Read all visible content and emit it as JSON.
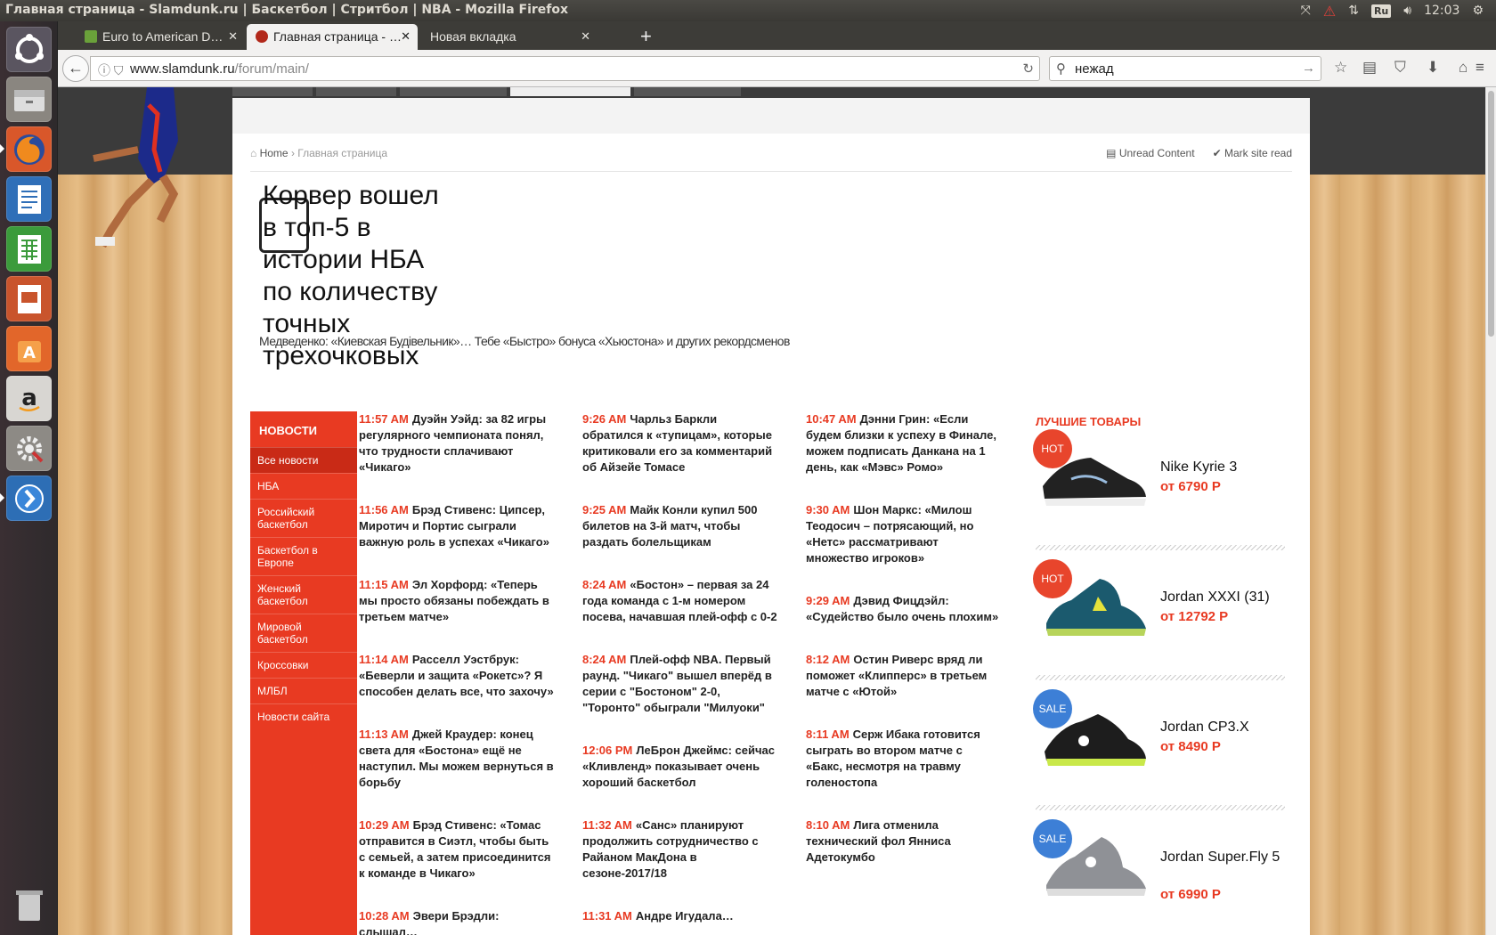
{
  "os": {
    "window_title": "Главная страница - Slamdunk.ru | Баскетбол | Стритбол | NBA - Mozilla Firefox",
    "keyboard_layout": "Ru",
    "clock": "12:03"
  },
  "browser": {
    "tabs": [
      {
        "label": "Euro to American D…"
      },
      {
        "label": "Главная страница - …"
      },
      {
        "label": "Новая вкладка"
      }
    ],
    "url_host": "www.slamdunk.ru",
    "url_path": "/forum/main/",
    "search_value": "нежад"
  },
  "page": {
    "breadcrumb": {
      "home": "Home",
      "current": "Главная страница"
    },
    "top_links": {
      "unread": "Unread Content",
      "mark_read": "Mark site read"
    },
    "featured": {
      "title": "Корвер вошел в топ-5 в истории НБА по количеству точных трехочковых",
      "overlapping_text": "Медведенко: «Киевская Будівельник»… Тебе «Быстро» бонуса «Хьюстона» и других рекордсменов"
    },
    "categories": {
      "header": "НОВОСТИ",
      "items": [
        "Все новости",
        "НБА",
        "Российский баскетбол",
        "Баскетбол в Европе",
        "Женский баскетбол",
        "Мировой баскетбол",
        "Кроссовки",
        "МЛБЛ",
        "Новости сайта"
      ]
    },
    "news_columns": [
      [
        {
          "time": "11:57 AM",
          "text": "Дуэйн Уэйд: за 82 игры регулярного чемпионата понял, что трудности сплачивают «Чикаго»"
        },
        {
          "time": "11:56 AM",
          "text": "Брэд Стивенс: Ципсер, Миротич и Портис сыграли важную роль в успехах «Чикаго»"
        },
        {
          "time": "11:15 AM",
          "text": "Эл Хорфорд: «Теперь мы просто обязаны побеждать в третьем матче»"
        },
        {
          "time": "11:14 AM",
          "text": "Расселл Уэстбрук: «Беверли и защита «Рокетс»? Я способен делать все, что захочу»"
        },
        {
          "time": "11:13 AM",
          "text": "Джей Краудер: конец света для «Бостона» ещё не наступил. Мы можем вернуться в борьбу"
        },
        {
          "time": "10:29 AM",
          "text": "Брэд Стивенс: «Томас отправится в Сиэтл, чтобы быть с семьей, а затем присоединится к команде в Чикаго»"
        },
        {
          "time": "10:28 AM",
          "text": "Эвери Брэдли: слышал…"
        }
      ],
      [
        {
          "time": "9:26 AM",
          "text": "Чарльз Баркли обратился к «тупицам», которые критиковали его за комментарий об Айзейе Томасе"
        },
        {
          "time": "9:25 AM",
          "text": "Майк Конли купил 500 билетов на 3-й матч, чтобы раздать болельщикам"
        },
        {
          "time": "8:24 AM",
          "text": "«Бостон» – первая за 24 года команда с 1-м номером посева, начавшая плей-офф с 0-2"
        },
        {
          "time": "8:24 AM",
          "text": "Плей-офф NBA. Первый раунд. \"Чикаго\" вышел вперёд в серии с \"Бостоном\" 2-0, \"Торонто\" обыграли \"Милуоки\""
        },
        {
          "time": "12:06 PM",
          "text": "ЛеБрон Джеймс: сейчас «Кливленд» показывает очень хороший баскетбол"
        },
        {
          "time": "11:32 AM",
          "text": "«Санс» планируют продолжить сотрудничество с Райаном МакДона в сезоне-2017/18"
        },
        {
          "time": "11:31 AM",
          "text": "Андре Игудала…"
        }
      ],
      [
        {
          "time": "10:47 AM",
          "text": "Дэнни Грин: «Если будем близки к успеху в Финале, можем подписать Данкана на 1 день, как «Мэвс» Ромо»"
        },
        {
          "time": "9:30 AM",
          "text": "Шон Маркс: «Милош Теодосич – потрясающий, но «Нетс» рассматривают множество игроков»"
        },
        {
          "time": "9:29 AM",
          "text": "Дэвид Фицдэйл: «Судейство было очень плохим»"
        },
        {
          "time": "8:12 AM",
          "text": "Остин Риверс вряд ли поможет «Клипперс» в третьем матче с «Ютой»"
        },
        {
          "time": "8:11 AM",
          "text": "Серж Ибака готовится сыграть во втором матче с «Бакс, несмотря на травму голеностопа"
        },
        {
          "time": "8:10 AM",
          "text": "Лига отменила технический фол Янниса Адетокумбо"
        }
      ]
    ],
    "products": {
      "header": "ЛУЧШИЕ ТОВАРЫ",
      "items": [
        {
          "badge": "HOT",
          "name": "Nike Kyrie 3",
          "price": "от 6790 Р",
          "badge_color": "#e8452c"
        },
        {
          "badge": "HOT",
          "name": "Jordan XXXI (31)",
          "price": "от 12792 Р",
          "badge_color": "#e8452c"
        },
        {
          "badge": "SALE",
          "name": "Jordan CP3.X",
          "price": "от 8490 Р",
          "badge_color": "#3d7fd6"
        },
        {
          "badge": "SALE",
          "name": "Jordan Super.Fly 5",
          "price": "от 6990 Р",
          "badge_color": "#3d7fd6"
        }
      ]
    }
  },
  "colors": {
    "accent": "#e83a22",
    "launcher_bg": "#2e2a2c",
    "topbar": "#3c3b37"
  }
}
